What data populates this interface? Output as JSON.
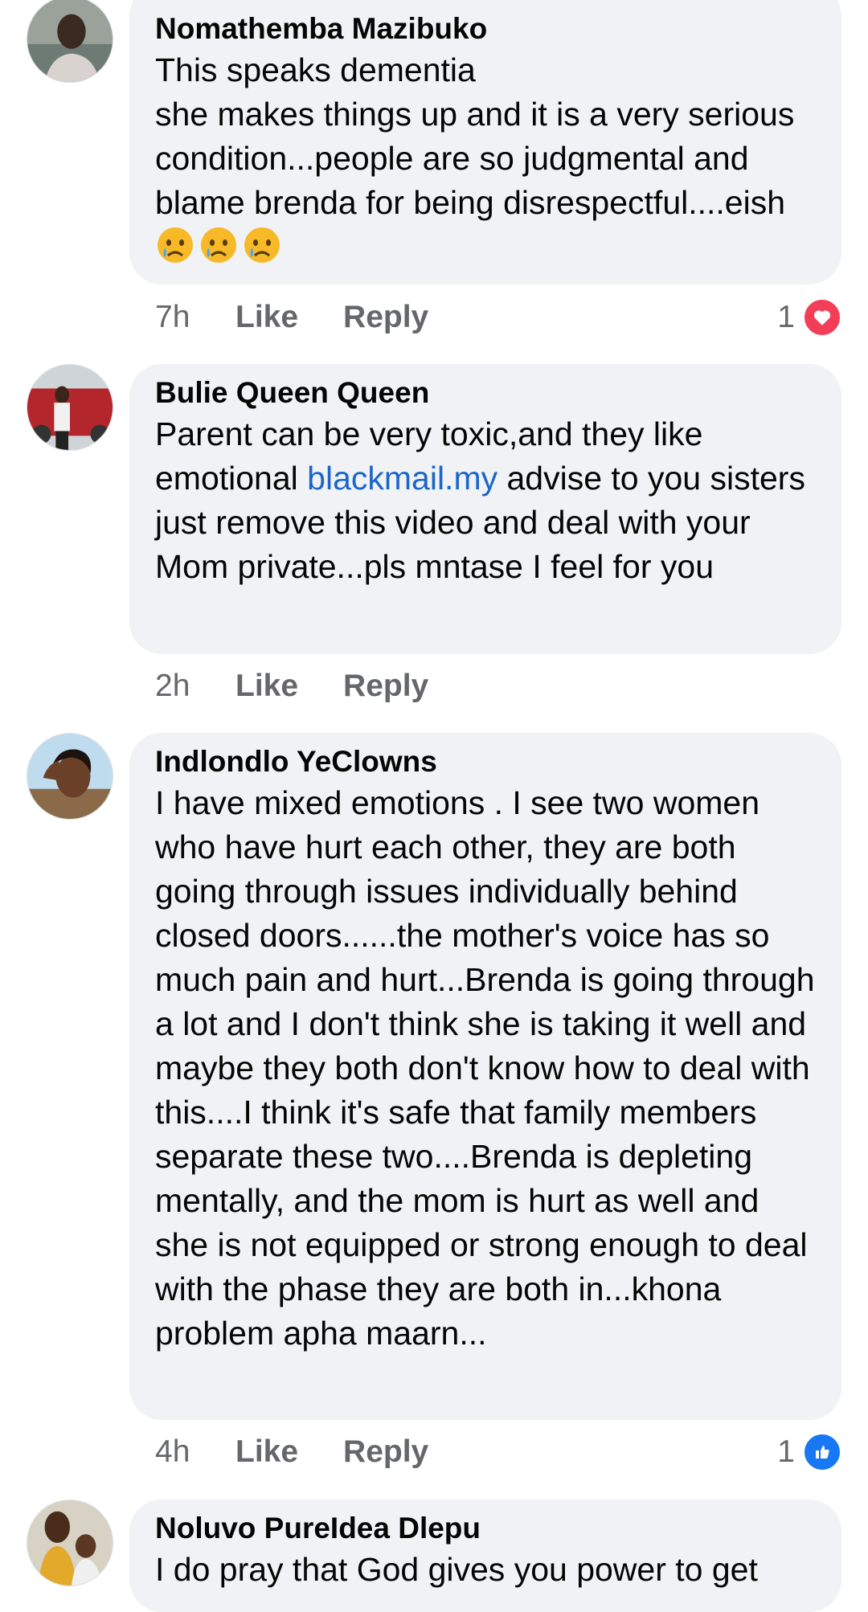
{
  "comments": [
    {
      "author": "Nomathemba Mazibuko",
      "text": "This speaks dementia\nshe makes things up and it is a very serious condition...people are so judgmental and blame brenda for being disrespectful....eish",
      "emoji": [
        "crying-face",
        "crying-face",
        "crying-face"
      ],
      "time": "7h",
      "like_label": "Like",
      "reply_label": "Reply",
      "reaction": {
        "count": "1",
        "type": "love",
        "color": "#f33e58"
      }
    },
    {
      "author": "Bulie Queen Queen",
      "text_before_link": "Parent can be very toxic,and they like emotional ",
      "link_text": "blackmail.my",
      "text_after_link": " advise to you sisters just remove this video and deal with your Mom private...pls mntase I feel for you",
      "time": "2h",
      "like_label": "Like",
      "reply_label": "Reply"
    },
    {
      "author": "Indlondlo YeClowns",
      "text": "I have mixed emotions . I see two women who have  hurt each other, they are both going through  issues individually behind closed doors......the mother's voice has so much pain and hurt...Brenda is going through a lot and I don't think she is taking it well and maybe they both don't know how to deal with this....I think it's safe that family members separate these two....Brenda is depleting mentally, and the mom is hurt as well and she is not equipped or strong enough to deal with the phase they are both in...khona problem apha maarn...",
      "time": "4h",
      "like_label": "Like",
      "reply_label": "Reply",
      "reaction": {
        "count": "1",
        "type": "like",
        "color": "#1877f2"
      }
    },
    {
      "author": "Noluvo PureIdea Dlepu",
      "text": "I do pray that God gives you power to get"
    }
  ],
  "colors": {
    "bubble": "#f0f2f5",
    "meta_text": "#65676b",
    "link": "#1b66c9"
  }
}
